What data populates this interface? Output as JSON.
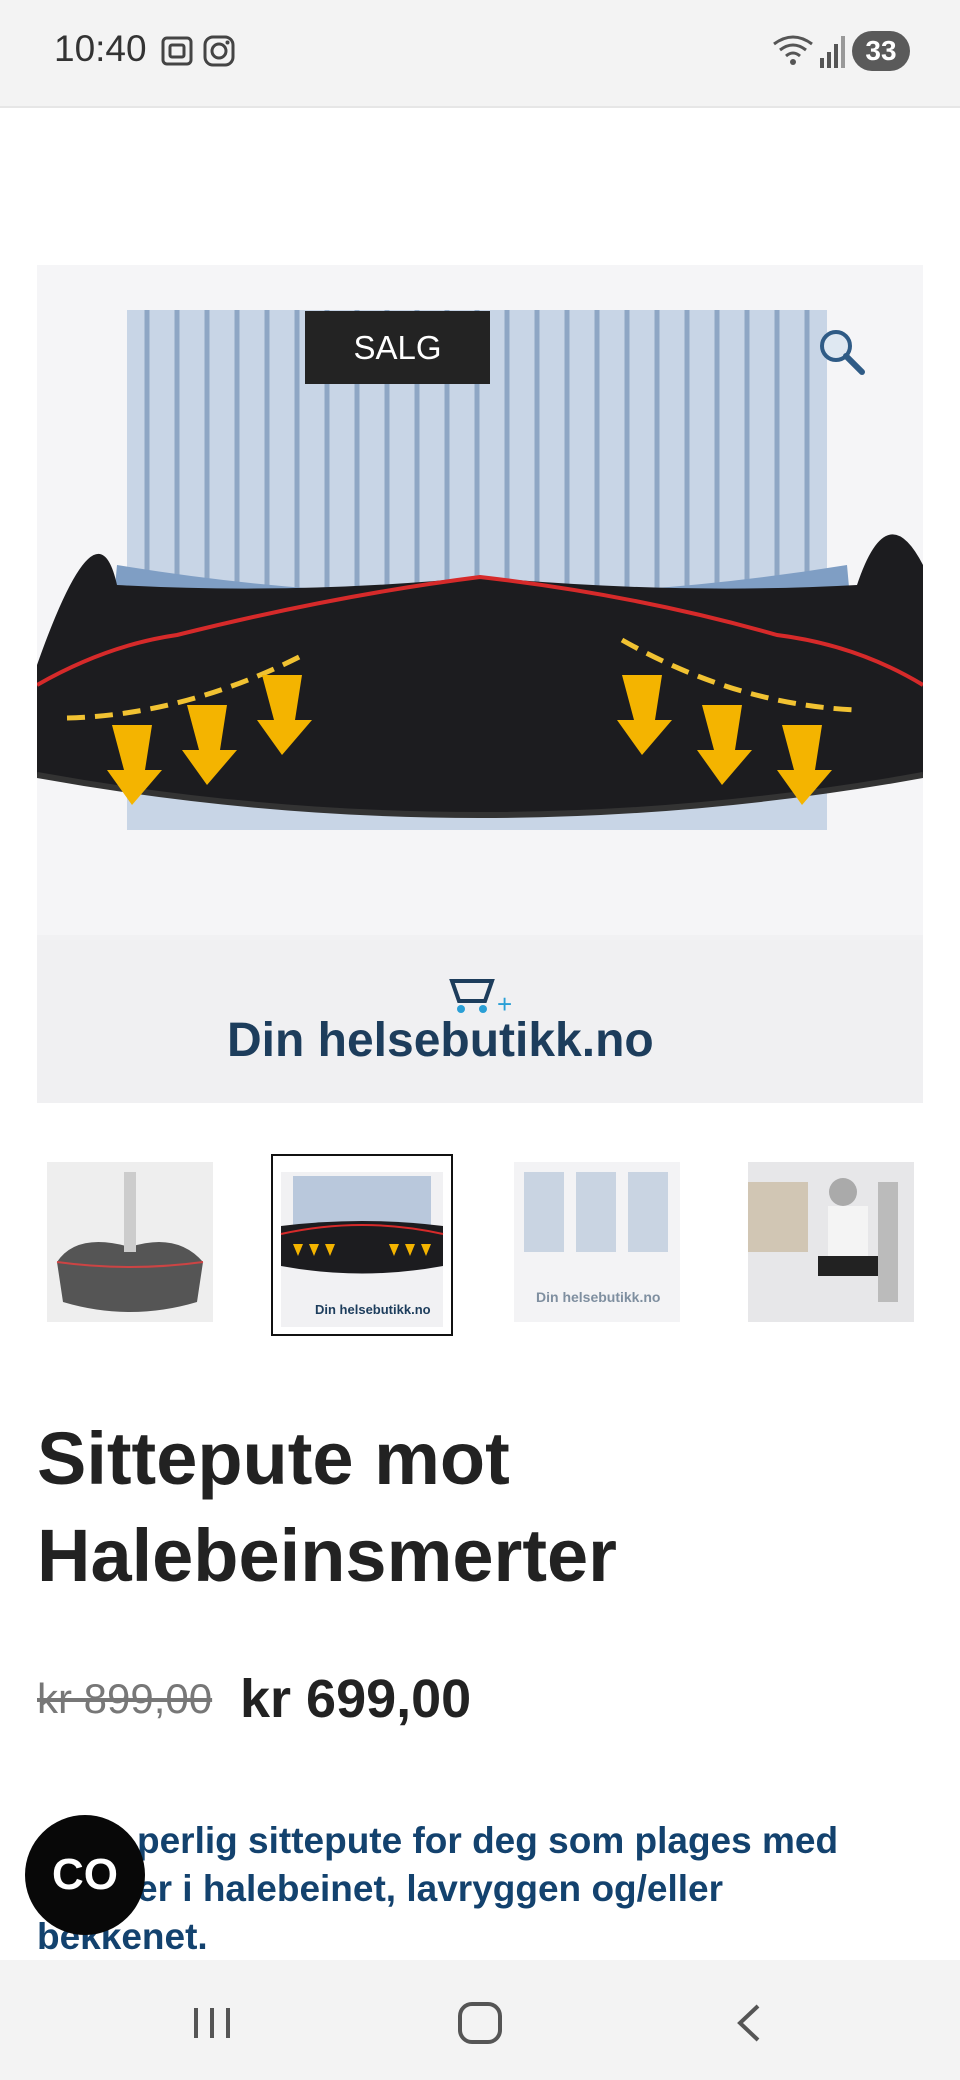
{
  "status_bar": {
    "time": "10:40",
    "left_icons": [
      "screenshot-icon",
      "instagram-icon"
    ],
    "right_icons": [
      "wifi-icon",
      "signal-icon"
    ],
    "battery": "33"
  },
  "product": {
    "sale_badge": "SALG",
    "image_brand_text": "Din helsebutikk.no",
    "title": "Sittepute mot Halebeinsmerter",
    "old_price": "kr 899,00",
    "new_price": "kr 699,00",
    "description_visible": "perlig sittepute for deg som plages med",
    "description_line2": "er i halebeinet, lavryggen og/eller",
    "description_line3": "bekkenet."
  },
  "thumbnails": [
    {
      "name": "spine-cushion"
    },
    {
      "name": "cushion-arrows"
    },
    {
      "name": "three-views"
    },
    {
      "name": "office-chair"
    }
  ],
  "chat": {
    "label": "CO"
  },
  "nav": {
    "icons": [
      "recent-apps-icon",
      "home-icon",
      "back-icon"
    ]
  },
  "colors": {
    "accent": "#13426e",
    "badge_bg": "#232323",
    "status_bg": "#f3f3f3"
  }
}
